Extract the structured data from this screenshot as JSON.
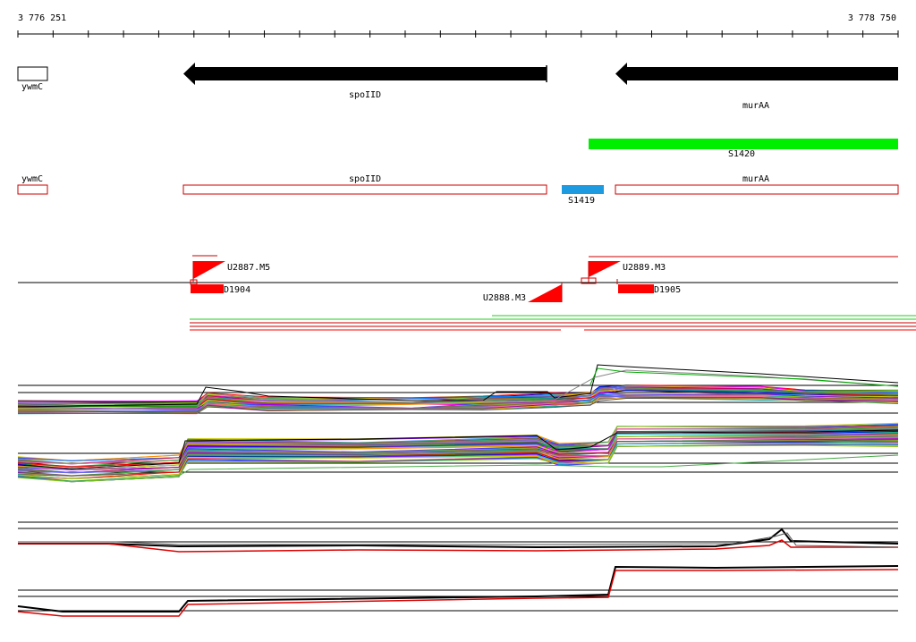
{
  "ruler": {
    "start_label": "3 776 251",
    "end_label": "3 778 750"
  },
  "genes_top": [
    {
      "name": "ywmC",
      "strand": "box"
    },
    {
      "name": "spoIID",
      "strand": "reverse"
    },
    {
      "name": "murAA",
      "strand": "reverse"
    }
  ],
  "segments": [
    {
      "name": "S1420",
      "color": "#00ee00"
    },
    {
      "name": "S1419",
      "color": "#1e9be0"
    }
  ],
  "gene_outlines": [
    {
      "name": "ywmC"
    },
    {
      "name": "spoIID"
    },
    {
      "name": "murAA"
    }
  ],
  "features": {
    "promoters": [
      "U2887.M5",
      "U2889.M3",
      "U2888.M3"
    ],
    "domains": [
      "D1904",
      "D1905"
    ]
  },
  "colors": {
    "accent_red": "#ff0000",
    "gene_outline": "#cc0000",
    "axis": "#000000"
  }
}
